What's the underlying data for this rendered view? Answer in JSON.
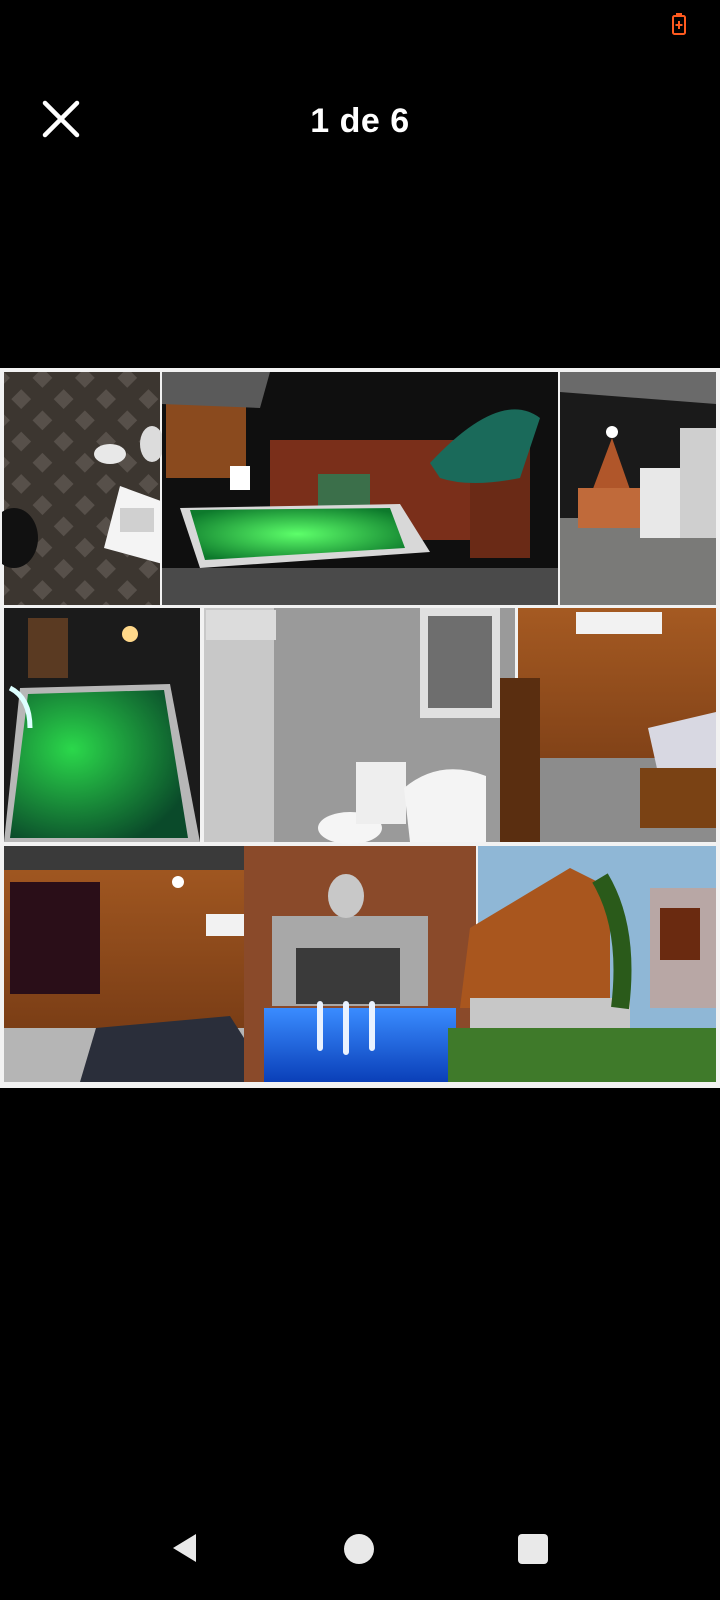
{
  "status_bar": {
    "battery_icon": "battery-charging-low-icon",
    "battery_color": "#ff5a1f"
  },
  "header": {
    "close_icon": "close-icon",
    "counter": "1 de 6"
  },
  "gallery": {
    "current_index": 1,
    "total": 6,
    "photos": [
      "bathroom-top-view",
      "pool-night-green",
      "covered-barbecue-patio",
      "pool-night-green-closeup",
      "bathroom-toilet-sink",
      "bedroom-wood-walls",
      "bedroom-curtains",
      "buddha-waterfall-pool",
      "wooden-house-exterior"
    ]
  },
  "nav_bar": {
    "back_icon": "back-triangle-icon",
    "home_icon": "home-circle-icon",
    "recents_icon": "recents-square-icon"
  }
}
